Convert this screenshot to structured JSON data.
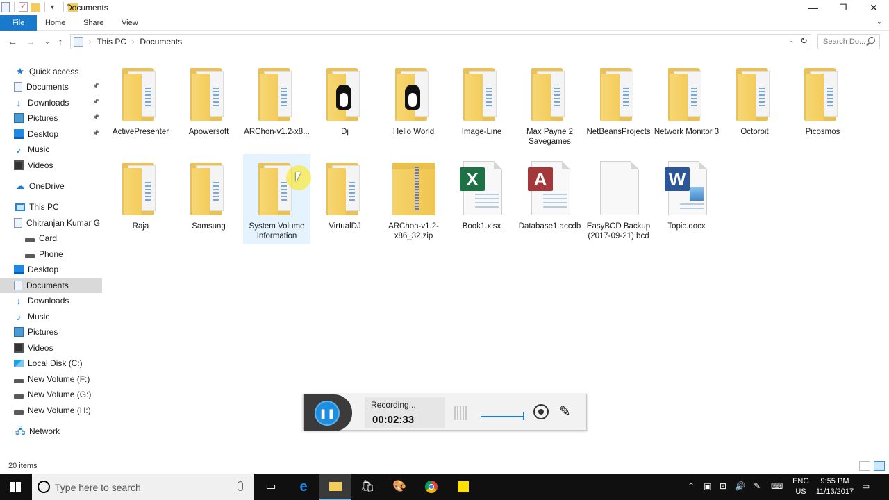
{
  "window": {
    "title": "Documents",
    "controls": {
      "minimize": "—",
      "restore": "❐",
      "close": "✕"
    }
  },
  "ribbon": {
    "tabs": [
      {
        "label": "File",
        "active": true
      },
      {
        "label": "Home"
      },
      {
        "label": "Share"
      },
      {
        "label": "View"
      }
    ]
  },
  "address": {
    "crumbs": [
      "This PC",
      "Documents"
    ],
    "search_placeholder": "Search Do..."
  },
  "sidebar": {
    "items": [
      {
        "label": "Quick access",
        "icon": "star-icon",
        "level": 0
      },
      {
        "label": "Documents",
        "icon": "documents-icon",
        "level": 1,
        "pinned": true
      },
      {
        "label": "Downloads",
        "icon": "downloads-icon",
        "level": 1,
        "pinned": true
      },
      {
        "label": "Pictures",
        "icon": "pictures-icon",
        "level": 1,
        "pinned": true
      },
      {
        "label": "Desktop",
        "icon": "desktop-icon",
        "level": 1,
        "pinned": true
      },
      {
        "label": "Music",
        "icon": "music-icon",
        "level": 1
      },
      {
        "label": "Videos",
        "icon": "videos-icon",
        "level": 1
      },
      {
        "label": "OneDrive",
        "icon": "onedrive-icon",
        "level": 0
      },
      {
        "label": "This PC",
        "icon": "this-pc-icon",
        "level": 0
      },
      {
        "label": "Chitranjan Kumar G",
        "icon": "phone-icon",
        "level": 1
      },
      {
        "label": "Card",
        "icon": "drive-icon",
        "level": 2
      },
      {
        "label": "Phone",
        "icon": "drive-icon",
        "level": 2
      },
      {
        "label": "Desktop",
        "icon": "desktop-icon",
        "level": 1
      },
      {
        "label": "Documents",
        "icon": "documents-icon",
        "level": 1,
        "selected": true
      },
      {
        "label": "Downloads",
        "icon": "downloads-icon",
        "level": 1
      },
      {
        "label": "Music",
        "icon": "music-icon",
        "level": 1
      },
      {
        "label": "Pictures",
        "icon": "pictures-icon",
        "level": 1
      },
      {
        "label": "Videos",
        "icon": "videos-icon",
        "level": 1
      },
      {
        "label": "Local Disk (C:)",
        "icon": "windows-drive-icon",
        "level": 1
      },
      {
        "label": "New Volume (F:)",
        "icon": "drive-icon",
        "level": 1
      },
      {
        "label": "New Volume (G:)",
        "icon": "drive-icon",
        "level": 1
      },
      {
        "label": "New Volume (H:)",
        "icon": "drive-icon",
        "level": 1
      },
      {
        "label": "Network",
        "icon": "network-icon",
        "level": 0
      }
    ]
  },
  "files": [
    {
      "label": "ActivePresenter",
      "type": "folder"
    },
    {
      "label": "Apowersoft",
      "type": "folder"
    },
    {
      "label": "ARChon-v1.2-x8...",
      "type": "folder"
    },
    {
      "label": "Dj",
      "type": "folder-penguin"
    },
    {
      "label": "Hello World",
      "type": "folder-penguin"
    },
    {
      "label": "Image-Line",
      "type": "folder"
    },
    {
      "label": "Max Payne 2 Savegames",
      "type": "folder"
    },
    {
      "label": "NetBeansProjects",
      "type": "folder"
    },
    {
      "label": "Network Monitor 3",
      "type": "folder"
    },
    {
      "label": "Octoroit",
      "type": "folder"
    },
    {
      "label": "Picosmos",
      "type": "folder"
    },
    {
      "label": "Raja",
      "type": "folder"
    },
    {
      "label": "Samsung",
      "type": "folder"
    },
    {
      "label": "System Volume Information",
      "type": "folder",
      "hover": true
    },
    {
      "label": "VirtualDJ",
      "type": "folder"
    },
    {
      "label": "ARChon-v1.2-x86_32.zip",
      "type": "zip"
    },
    {
      "label": "Book1.xlsx",
      "type": "excel"
    },
    {
      "label": "Database1.accdb",
      "type": "access"
    },
    {
      "label": "EasyBCD Backup (2017-09-21).bcd",
      "type": "blank"
    },
    {
      "label": "Topic.docx",
      "type": "word"
    }
  ],
  "recorder": {
    "status": "Recording...",
    "time": "00:02:33"
  },
  "statusbar": {
    "count": "20 items"
  },
  "taskbar": {
    "search_placeholder": "Type here to search",
    "lang_top": "ENG",
    "lang_bottom": "US",
    "time": "9:55 PM",
    "date": "11/13/2017"
  },
  "colors": {
    "accent": "#1979ca",
    "folder": "#f3cc5c",
    "selected": "#d9d9d9",
    "hover": "#e5f3ff"
  }
}
